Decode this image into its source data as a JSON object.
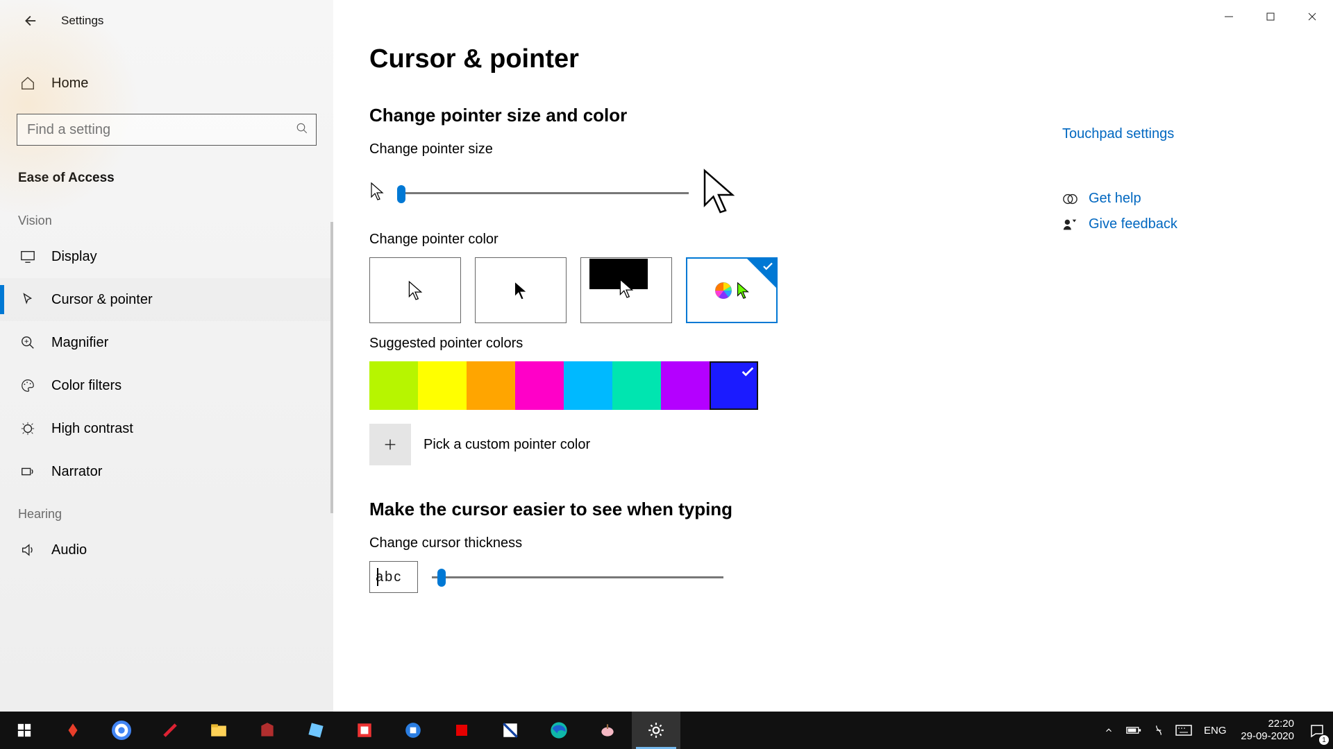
{
  "window": {
    "title": "Settings"
  },
  "sidebar": {
    "home": "Home",
    "search_placeholder": "Find a setting",
    "section": "Ease of Access",
    "cats": {
      "vision": "Vision",
      "hearing": "Hearing"
    },
    "items": {
      "display": "Display",
      "cursor": "Cursor & pointer",
      "magnifier": "Magnifier",
      "colorfilters": "Color filters",
      "highcontrast": "High contrast",
      "narrator": "Narrator",
      "audio": "Audio"
    }
  },
  "page": {
    "title": "Cursor & pointer",
    "sec1": "Change pointer size and color",
    "size_label": "Change pointer size",
    "color_label": "Change pointer color",
    "suggested_label": "Suggested pointer colors",
    "custom_label": "Pick a custom pointer color",
    "sec2": "Make the cursor easier to see when typing",
    "thickness_label": "Change cursor thickness",
    "abc": "abc"
  },
  "suggested_colors": [
    "#b7f500",
    "#ffff00",
    "#ffa500",
    "#ff00c8",
    "#00b9ff",
    "#00e5b0",
    "#b400ff",
    "#1b1bff"
  ],
  "selected_swatch": 7,
  "rail": {
    "touchpad": "Touchpad settings",
    "help": "Get help",
    "feedback": "Give feedback"
  },
  "taskbar": {
    "lang": "ENG",
    "time": "22:20",
    "date": "29-09-2020",
    "notif_count": "1"
  }
}
